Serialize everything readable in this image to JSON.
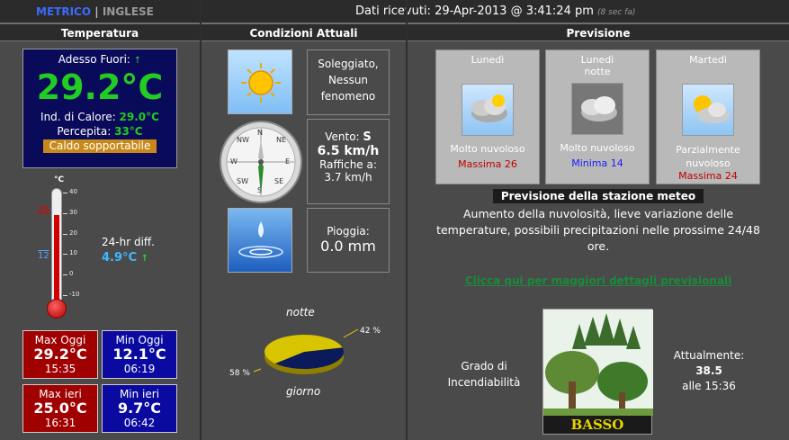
{
  "topbar": {
    "units_metric": "METRICO",
    "units_sep": "|",
    "units_english": "INGLESE",
    "received_label": "Dati ricevuti: 29-Apr-2013 @ 3:41:24 pm",
    "age_label": "(8 sec fa)"
  },
  "temperatura": {
    "header": "Temperatura",
    "outside_label": "Adesso Fuori:",
    "current_temp": "29.2°C",
    "heat_index_label": "Ind. di Calore:",
    "heat_index_value": "29.0°C",
    "feels_label": "Percepita:",
    "feels_value": "33°C",
    "comfort_label": "Caldo sopportabile",
    "thermo_unit": "°C",
    "thermo_ticks": [
      "40",
      "30",
      "20",
      "10",
      "0",
      "-10"
    ],
    "thermo_level": 29.2,
    "thermo_max_marker": "29",
    "thermo_min_marker": "12",
    "diff_label": "24-hr diff.",
    "diff_value": "4.9°C",
    "max_today_label": "Max Oggi",
    "max_today_value": "29.2°C",
    "max_today_time": "15:35",
    "min_today_label": "Min Oggi",
    "min_today_value": "12.1°C",
    "min_today_time": "06:19",
    "max_yest_label": "Max ieri",
    "max_yest_value": "25.0°C",
    "max_yest_time": "16:31",
    "min_yest_label": "Min ieri",
    "min_yest_value": "9.7°C",
    "min_yest_time": "06:42"
  },
  "condizioni": {
    "header": "Condizioni Attuali",
    "sky_text": "Soleggiato, Nessun fenomeno",
    "compass_n": "N",
    "compass_ne": "NE",
    "compass_e": "E",
    "compass_se": "SE",
    "compass_s": "S",
    "compass_sw": "SW",
    "compass_w": "W",
    "compass_nw": "NW",
    "wind_label": "Vento:",
    "wind_dir": "S",
    "wind_speed": "6.5 km/h",
    "gust_label": "Raffiche a:",
    "gust_value": "3.7 km/h",
    "rain_label": "Pioggia:",
    "rain_value": "0.0 mm",
    "night_label": "notte",
    "day_label": "giorno",
    "night_pct": "42 %",
    "day_pct": "58 %"
  },
  "previsione": {
    "header": "Previsione",
    "day1_name": "Lunedì",
    "day1_desc": "Molto nuvoloso",
    "day1_temp": "Massima 26",
    "day2_name": "Lunedì",
    "day2_sub": "notte",
    "day2_desc": "Molto nuvoloso",
    "day2_temp": "Minima 14",
    "day3_name": "Martedì",
    "day3_desc": "Parzialmente nuvoloso",
    "day3_temp": "Massima 24",
    "station_title": "Previsione della stazione meteo",
    "station_text": "Aumento della nuvolosità, lieve variazione delle temperature, possibili precipitazioni nelle prossime 24/48 ore.",
    "details_link": "Clicca qui per maggiori dettagli previsionali",
    "fire_label": "Grado di Incendiabilità",
    "fire_level": "BASSO",
    "now_label": "Attualmente:",
    "now_value": "38.5",
    "now_time": "alle 15:36"
  },
  "chart_data": {
    "type": "pie",
    "categories": [
      "notte",
      "giorno"
    ],
    "values": [
      42,
      58
    ],
    "colors": [
      "#0a1a5a",
      "#d9c400"
    ]
  }
}
